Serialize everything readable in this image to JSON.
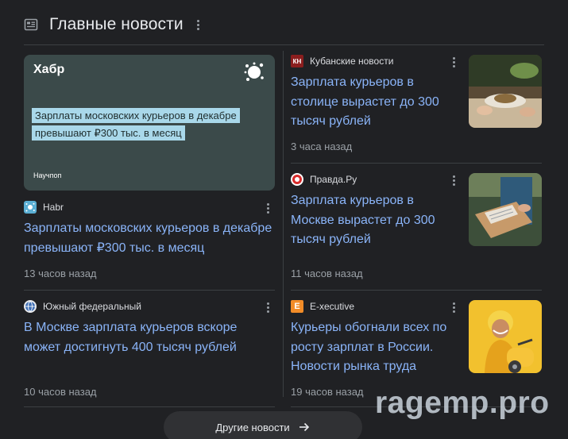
{
  "header": {
    "title": "Главные новости",
    "icon": "newspaper-icon"
  },
  "feature": {
    "image": {
      "brand": "Хабр",
      "headline": "Зарплаты московских курьеров в декабре превышают ₽300 тыс. в месяц",
      "footer": "Научпоп"
    },
    "source": "Habr",
    "headline": "Зарплаты московских курьеров в декабре превышают ₽300 тыс. в месяц",
    "time": "13 часов назад"
  },
  "stories": [
    {
      "logo_text": "КН",
      "source": "Кубанские новости",
      "headline": "Зарплата курьеров в столице вырастет до 300 тысяч рублей",
      "time": "3 часа назад"
    },
    {
      "logo_text": "",
      "source": "Правда.Ру",
      "headline": "Зарплата курьеров в Москве вырастет до 300 тысяч рублей",
      "time": "11 часов назад"
    },
    {
      "logo_text": "",
      "source": "Южный федеральный",
      "headline": "В Москве зарплата курьеров вскоре может достигнуть 400 тысяч рублей",
      "time": "10 часов назад"
    },
    {
      "logo_text": "E",
      "source": "E-xecutive",
      "headline": "Курьеры обогнали всех по росту зарплат в России. Новости рынка труда",
      "time": "19 часов назад"
    }
  ],
  "more_button": {
    "label": "Другие новости",
    "icon": "arrow-right-icon"
  },
  "watermark": "ragemp.pro",
  "colors": {
    "background": "#202124",
    "link": "#8ab4f8",
    "muted": "#9aa0a6"
  }
}
